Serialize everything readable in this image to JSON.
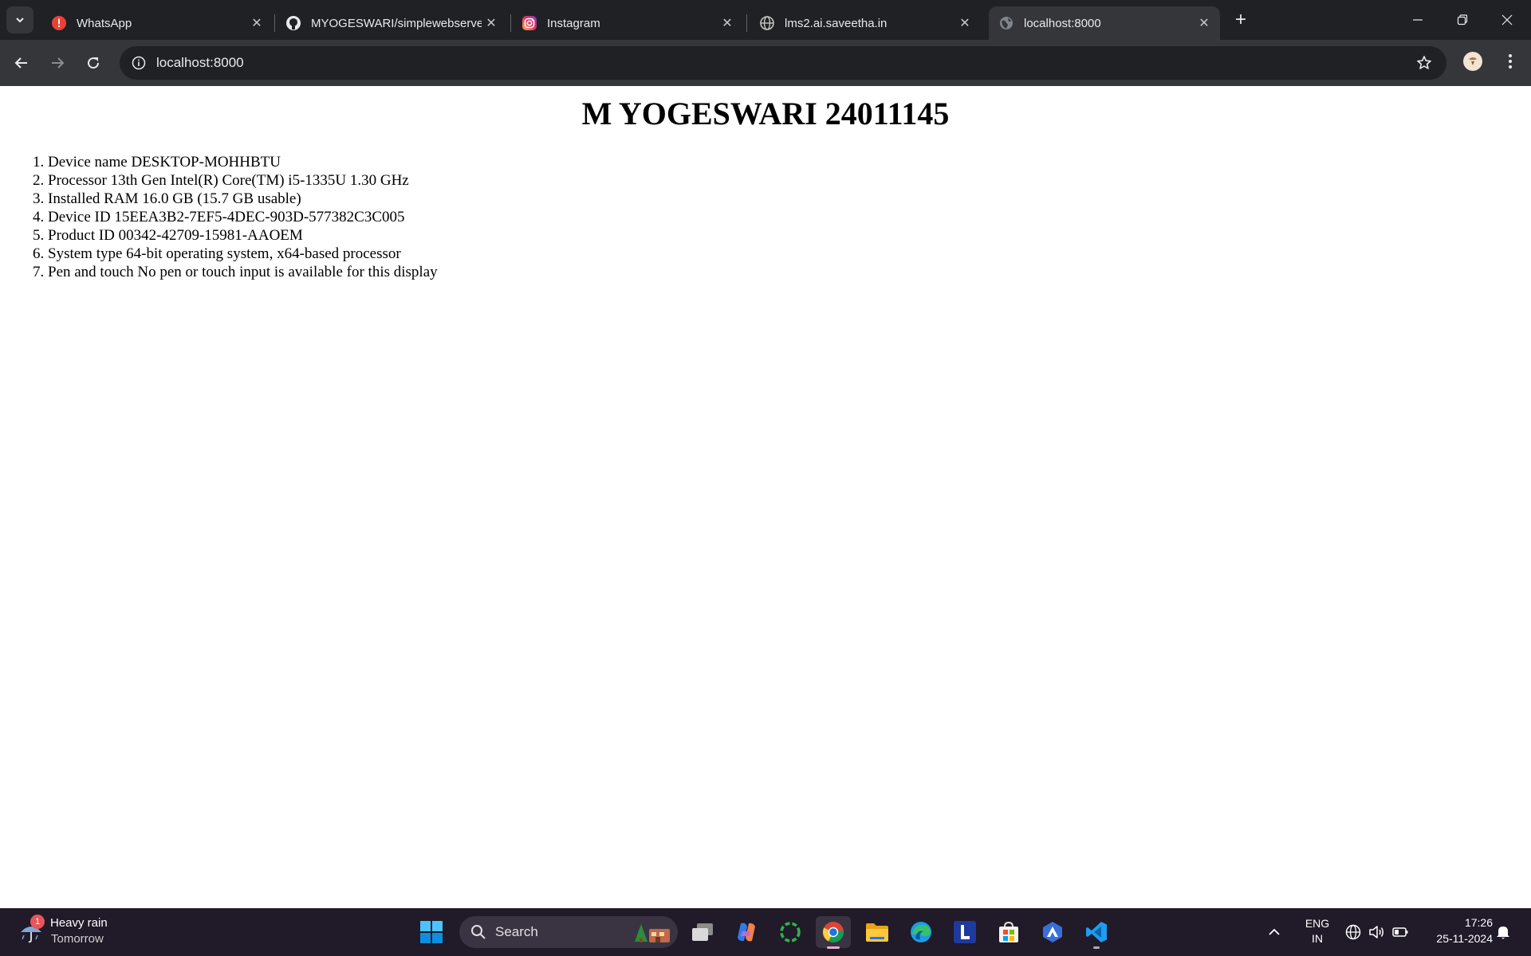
{
  "browser": {
    "tabs": [
      {
        "title": "WhatsApp",
        "icon": "whatsapp-alert-icon",
        "active": false
      },
      {
        "title": "MYOGESWARI/simplewebserver",
        "icon": "github-icon",
        "active": false
      },
      {
        "title": "Instagram",
        "icon": "instagram-icon",
        "active": false
      },
      {
        "title": "lms2.ai.saveetha.in",
        "icon": "globe-icon",
        "active": false
      },
      {
        "title": "localhost:8000",
        "icon": "globe-icon",
        "active": true
      }
    ],
    "address": "localhost:8000"
  },
  "page": {
    "heading": "M YOGESWARI 24011145",
    "items": [
      "Device name DESKTOP-MOHHBTU",
      "Processor 13th Gen Intel(R) Core(TM) i5-1335U 1.30 GHz",
      "Installed RAM 16.0 GB (15.7 GB usable)",
      "Device ID 15EEA3B2-7EF5-4DEC-903D-577382C3C005",
      "Product ID 00342-42709-15981-AAOEM",
      "System type 64-bit operating system, x64-based processor",
      "Pen and touch No pen or touch input is available for this display"
    ]
  },
  "taskbar": {
    "weather": {
      "badge": "1",
      "title": "Heavy rain",
      "subtitle": "Tomorrow"
    },
    "search_label": "Search",
    "apps": [
      "task-view",
      "copilot",
      "green-ring-app",
      "chrome",
      "file-explorer",
      "edge",
      "l-app",
      "microsoft-store",
      "arc-app",
      "vscode"
    ],
    "lang_line1": "ENG",
    "lang_line2": "IN",
    "time": "17:26",
    "date": "25-11-2024"
  },
  "colors": {
    "tab_bar": "#202124",
    "toolbar": "#35363a",
    "taskbar": "#201a29",
    "page_bg": "#ffffff"
  }
}
